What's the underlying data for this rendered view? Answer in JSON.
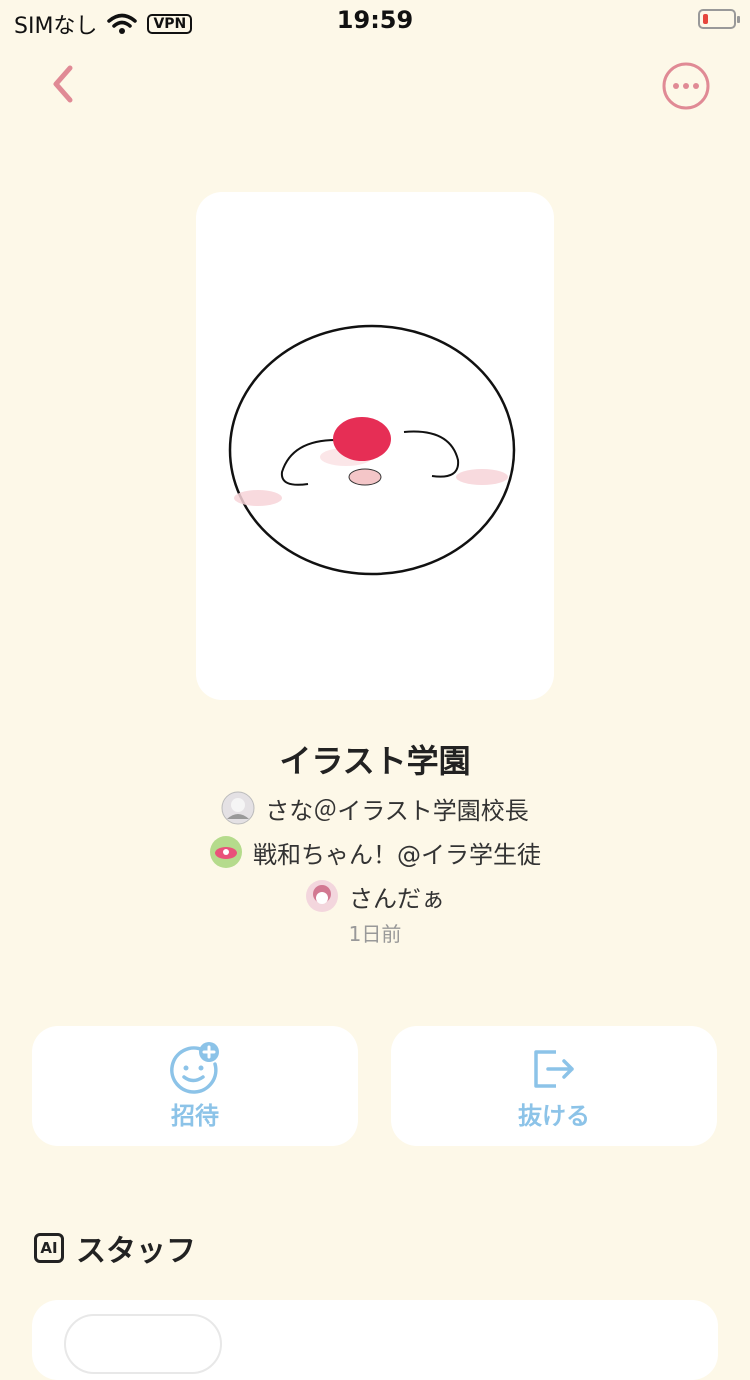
{
  "status_bar": {
    "carrier": "SIMなし",
    "vpn": "VPN",
    "time": "19:59",
    "battery_level": 0.1
  },
  "nav": {
    "back_icon": "chevron-left-icon",
    "more_icon": "more-horizontal-icon",
    "accent_color": "#E08A95"
  },
  "group": {
    "title": "イラスト学園",
    "members": [
      {
        "name": "さな＠イラスト学園校長"
      },
      {
        "name": "戦和ちゃん！@イラ学生徒"
      },
      {
        "name": "さんだぁ"
      }
    ],
    "updated": "1日前"
  },
  "actions": {
    "invite_label": "招待",
    "leave_label": "抜ける",
    "color": "#8CC3E8"
  },
  "staff_section": {
    "badge": "AI",
    "title": "スタッフ"
  },
  "colors": {
    "background": "#FDF8E8",
    "card": "#FFFFFF"
  }
}
